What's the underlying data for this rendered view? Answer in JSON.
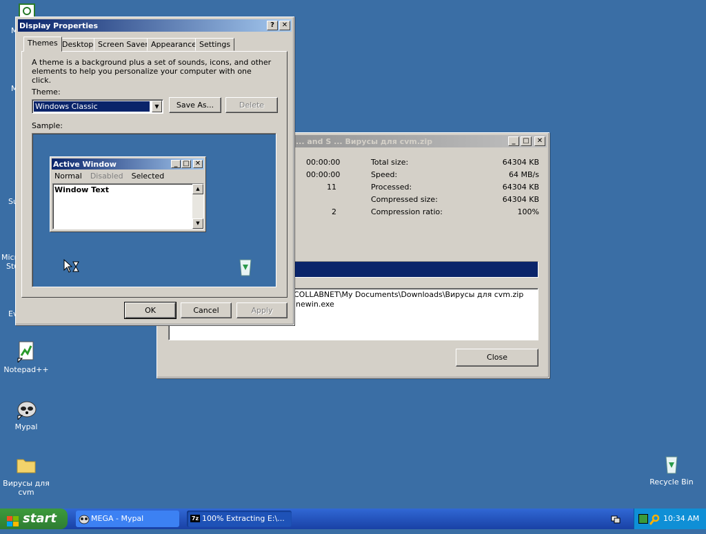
{
  "desktop": {
    "icons": [
      {
        "label": "Notepad++"
      },
      {
        "label": "Mypal"
      },
      {
        "label": "Вирусы для cvm"
      },
      {
        "label": "Recycle Bin"
      }
    ],
    "left_fragments": [
      "M",
      "M",
      "Su",
      "Micr",
      "Stu",
      "Ev"
    ]
  },
  "display_properties": {
    "title": "Display Properties",
    "title_buttons": [
      "?",
      "✕"
    ],
    "tabs": [
      "Themes",
      "Desktop",
      "Screen Saver",
      "Appearance",
      "Settings"
    ],
    "description": "A theme is a background plus a set of sounds, icons, and other elements to help you personalize your computer with one click.",
    "theme_label": "Theme:",
    "theme_value": "Windows Classic",
    "save_as_label": "Save As...",
    "delete_label": "Delete",
    "sample_label": "Sample:",
    "sample": {
      "window_title": "Active Window",
      "menu": [
        "Normal",
        "Disabled",
        "Selected"
      ],
      "window_text": "Window Text"
    },
    "ok_label": "OK",
    "cancel_label": "Cancel",
    "apply_label": "Apply"
  },
  "extract_window": {
    "title": "... and S ... Вирусы для cvm.zip",
    "left_values": [
      "00:00:00",
      "00:00:00",
      "11",
      "",
      "2"
    ],
    "stats": [
      {
        "label": "Total size:",
        "value": "64304 KB"
      },
      {
        "label": "Speed:",
        "value": "64 MB/s"
      },
      {
        "label": "Processed:",
        "value": "64304 KB"
      },
      {
        "label": "Compressed size:",
        "value": "64304 KB"
      },
      {
        "label": "Compression ratio:",
        "value": "100%"
      }
    ],
    "progress": 1.0,
    "log_lines": [
      "COLLABNET\\My Documents\\Downloads\\Вирусы для cvm.zip",
      "inewin.exe"
    ],
    "close_label": "Close"
  },
  "taskbar": {
    "start_label": "start",
    "tasks": [
      {
        "label": "MEGA - Mypal"
      },
      {
        "label": "100% Extracting E:\\..."
      }
    ],
    "clock": "10:34 AM"
  },
  "colors": {
    "desktop": "#3a6ea5",
    "active_title": "#0a246a",
    "selection": "#0a246a",
    "taskbar": "#245edb"
  }
}
